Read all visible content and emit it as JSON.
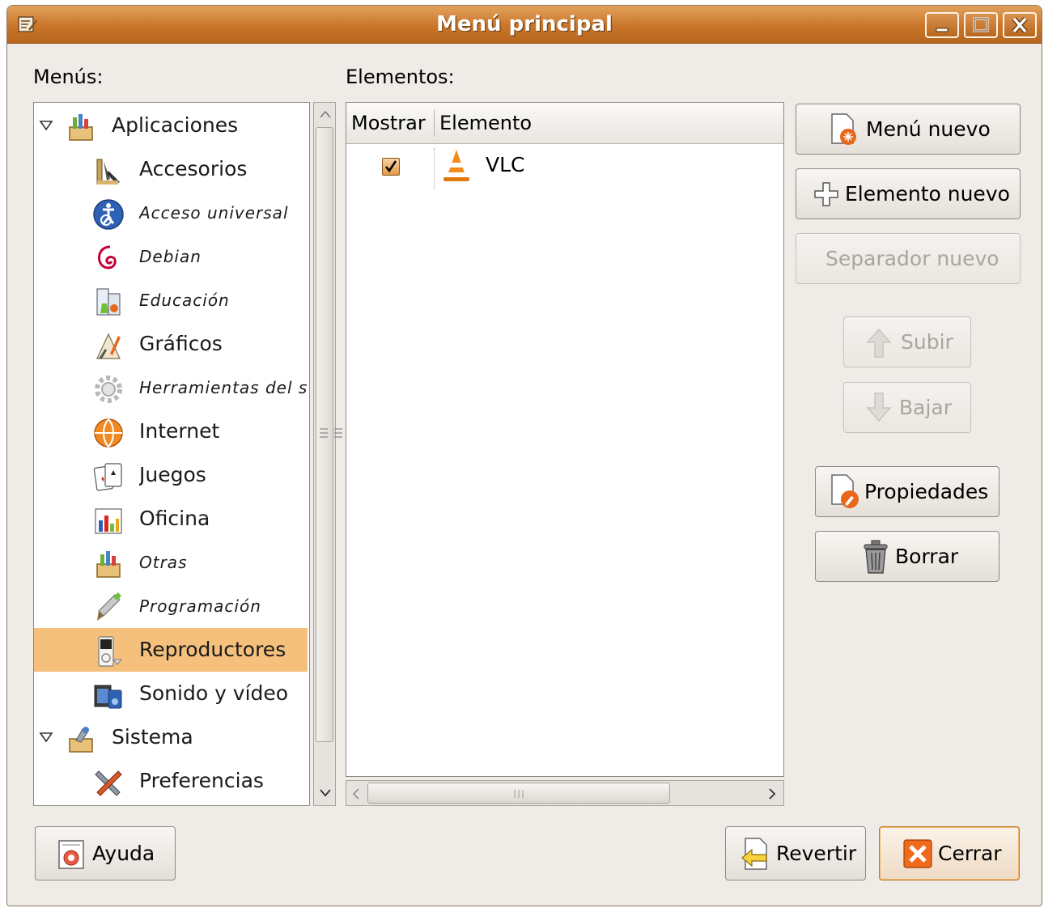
{
  "window": {
    "title": "Menú principal"
  },
  "labels": {
    "menus": "Menús:",
    "elements": "Elementos:"
  },
  "tree": {
    "root1": "Aplicaciones",
    "items": [
      {
        "label": "Accesorios",
        "icon": "accessories-icon",
        "italic": false
      },
      {
        "label": "Acceso universal",
        "icon": "accessibility-icon",
        "italic": true
      },
      {
        "label": "Debian",
        "icon": "debian-icon",
        "italic": true
      },
      {
        "label": "Educación",
        "icon": "education-icon",
        "italic": true
      },
      {
        "label": "Gráficos",
        "icon": "graphics-icon",
        "italic": false
      },
      {
        "label": "Herramientas del s",
        "icon": "system-tools-icon",
        "italic": true
      },
      {
        "label": "Internet",
        "icon": "internet-icon",
        "italic": false
      },
      {
        "label": "Juegos",
        "icon": "games-icon",
        "italic": false
      },
      {
        "label": "Oficina",
        "icon": "office-icon",
        "italic": false
      },
      {
        "label": "Otras",
        "icon": "other-icon",
        "italic": true
      },
      {
        "label": "Programación",
        "icon": "programming-icon",
        "italic": true
      },
      {
        "label": "Reproductores",
        "icon": "media-player-icon",
        "italic": false,
        "selected": true
      },
      {
        "label": "Sonido y vídeo",
        "icon": "sound-video-icon",
        "italic": false
      }
    ],
    "root2": "Sistema",
    "sub2": "Preferencias"
  },
  "list": {
    "col_show": "Mostrar",
    "col_element": "Elemento",
    "rows": [
      {
        "checked": true,
        "name": "VLC",
        "icon": "vlc-icon"
      }
    ]
  },
  "buttons": {
    "new_menu": "Menú nuevo",
    "new_item": "Elemento nuevo",
    "new_separator": "Separador nuevo",
    "move_up": "Subir",
    "move_down": "Bajar",
    "properties": "Propiedades",
    "delete": "Borrar",
    "help": "Ayuda",
    "revert": "Revertir",
    "close": "Cerrar"
  },
  "colors": {
    "title_bar": "#c9762b",
    "selection": "#f5c07c",
    "window_bg": "#efebe7"
  }
}
